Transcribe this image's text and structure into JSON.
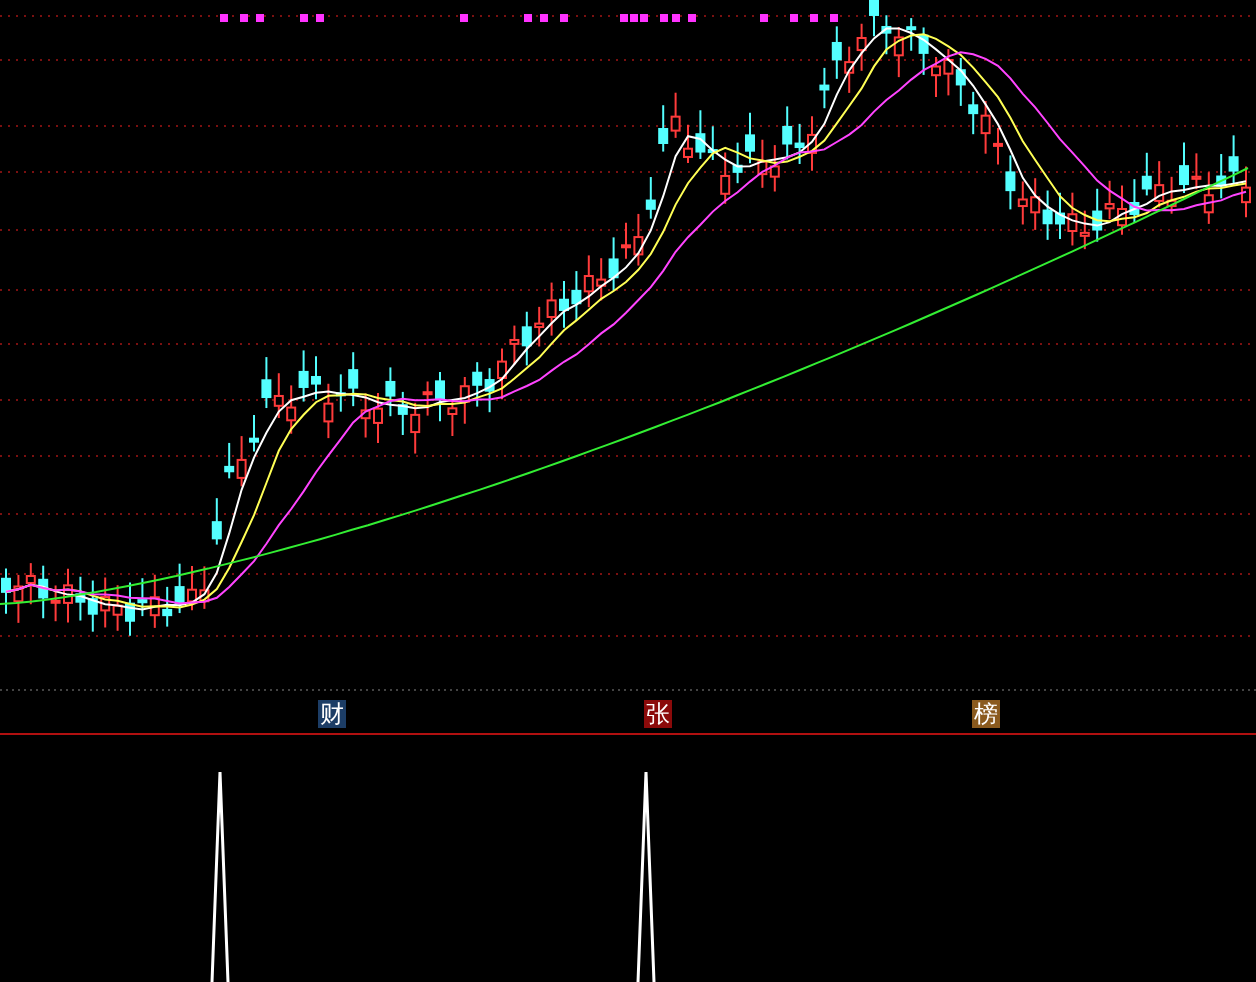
{
  "signal_labels": [
    {
      "text": "财",
      "color": "#1c3d66"
    },
    {
      "text": "张",
      "color": "#8b0a0a"
    },
    {
      "text": "榜",
      "color": "#8a5a1e"
    }
  ]
}
